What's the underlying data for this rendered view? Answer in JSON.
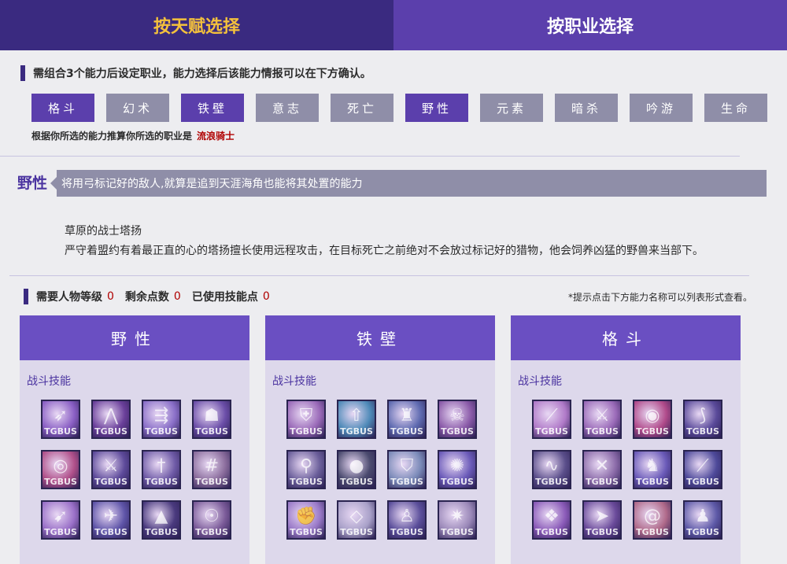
{
  "tabs": {
    "by_talent": "按天赋选择",
    "by_job": "按职业选择"
  },
  "intro_text": "需组合3个能力后设定职业，能力选择后该能力情报可以在下方确认。",
  "talents": [
    {
      "label": "格斗",
      "selected": true
    },
    {
      "label": "幻术",
      "selected": false
    },
    {
      "label": "铁壁",
      "selected": true
    },
    {
      "label": "意志",
      "selected": false
    },
    {
      "label": "死亡",
      "selected": false
    },
    {
      "label": "野性",
      "selected": true
    },
    {
      "label": "元素",
      "selected": false
    },
    {
      "label": "暗杀",
      "selected": false
    },
    {
      "label": "吟游",
      "selected": false
    },
    {
      "label": "生命",
      "selected": false
    }
  ],
  "result": {
    "label": "根据你所选的能力推算你所选的职业是",
    "job": "流浪骑士"
  },
  "ability": {
    "title": "野性",
    "description": "将用弓标记好的敌人,就算是追到天涯海角也能将其处置的能力"
  },
  "job_info": {
    "name": "草原的战士塔扬",
    "description": "严守着盟约有着最正直的心的塔扬擅长使用远程攻击，在目标死亡之前绝对不会放过标记好的猎物，他会饲养凶猛的野兽来当部下。"
  },
  "stats": {
    "level_label": "需要人物等级",
    "level_value": "0",
    "remaining_label": "剩余点数",
    "remaining_value": "0",
    "used_label": "已使用技能点",
    "used_value": "0",
    "hint": "*提示点击下方能力名称可以列表形式查看。"
  },
  "watermark": "TGBUS",
  "panels": [
    {
      "title": "野性",
      "subtitle": "战斗技能",
      "skills": [
        {
          "icon": "arrow-shot-icon",
          "color": "#8a5fc4"
        },
        {
          "icon": "wing-icon",
          "color": "#6a3f9a"
        },
        {
          "icon": "multi-arrow-icon",
          "color": "#8a6fc8"
        },
        {
          "icon": "beast-icon",
          "color": "#6b4ea8"
        },
        {
          "icon": "target-icon",
          "color": "#b0508a"
        },
        {
          "icon": "claw-icon",
          "color": "#5d4a9a"
        },
        {
          "icon": "dagger-icon",
          "color": "#6e5aa6"
        },
        {
          "icon": "net-icon",
          "color": "#8a6c9c"
        },
        {
          "icon": "volley-icon",
          "color": "#9a70c8"
        },
        {
          "icon": "bird-icon",
          "color": "#5e54a8"
        },
        {
          "icon": "hood-icon",
          "color": "#4a3a7e"
        },
        {
          "icon": "spirit-icon",
          "color": "#7a5a98"
        }
      ]
    },
    {
      "title": "铁壁",
      "subtitle": "战斗技能",
      "skills": [
        {
          "icon": "shield-icon",
          "color": "#9a6ab8"
        },
        {
          "icon": "arrow-up-icon",
          "color": "#4e8ab8"
        },
        {
          "icon": "guard-icon",
          "color": "#5e6ab0"
        },
        {
          "icon": "skull-icon",
          "color": "#8a5aa8"
        },
        {
          "icon": "kick-icon",
          "color": "#6a5e9a"
        },
        {
          "icon": "bash-icon",
          "color": "#4a4a6e"
        },
        {
          "icon": "armor-icon",
          "color": "#7a8ab8"
        },
        {
          "icon": "aura-icon",
          "color": "#6a5ab8"
        },
        {
          "icon": "fist-icon",
          "color": "#9a7ac8"
        },
        {
          "icon": "cube-icon",
          "color": "#a8a0c8"
        },
        {
          "icon": "figure-icon",
          "color": "#5a4e9a"
        },
        {
          "icon": "burst-icon",
          "color": "#9a88b8"
        }
      ]
    },
    {
      "title": "格斗",
      "subtitle": "战斗技能",
      "skills": [
        {
          "icon": "slash-icon",
          "color": "#b07ac8"
        },
        {
          "icon": "sword-icon",
          "color": "#9a6ab8"
        },
        {
          "icon": "vortex-icon",
          "color": "#b04a8a"
        },
        {
          "icon": "blade-icon",
          "color": "#5a4a9a"
        },
        {
          "icon": "whip-icon",
          "color": "#5a4e8a"
        },
        {
          "icon": "strike-icon",
          "color": "#8a6aa8"
        },
        {
          "icon": "warrior-icon",
          "color": "#6a5ab8"
        },
        {
          "icon": "cleave-icon",
          "color": "#4e4a9a"
        },
        {
          "icon": "blood-icon",
          "color": "#8a5ab8"
        },
        {
          "icon": "rush-icon",
          "color": "#6a4a9a"
        },
        {
          "icon": "spiral-icon",
          "color": "#b06a8a"
        },
        {
          "icon": "fighter-icon",
          "color": "#5e5aa8"
        }
      ]
    }
  ]
}
